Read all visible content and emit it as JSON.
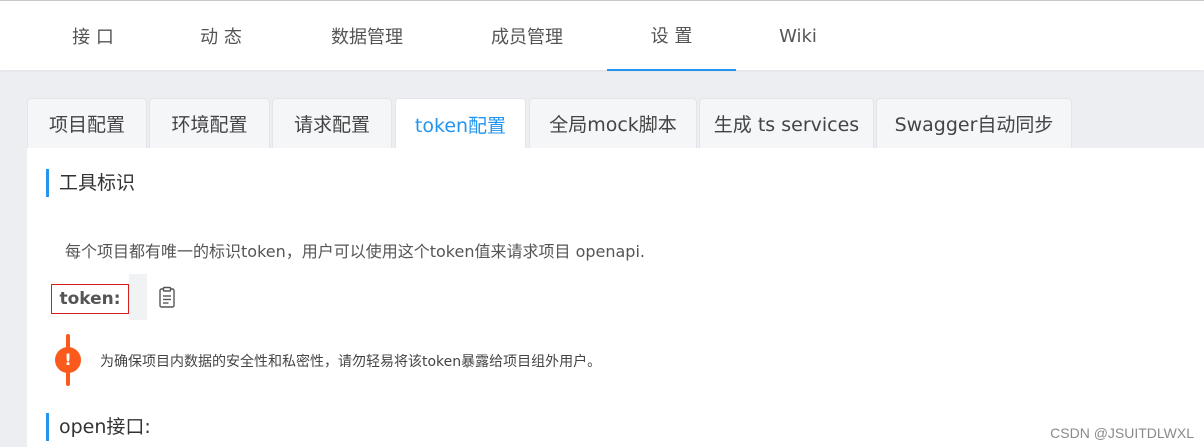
{
  "topnav": {
    "items": [
      {
        "label": "接 口",
        "active": false
      },
      {
        "label": "动 态",
        "active": false
      },
      {
        "label": "数据管理",
        "active": false
      },
      {
        "label": "成员管理",
        "active": false
      },
      {
        "label": "设 置",
        "active": true
      },
      {
        "label": "Wiki",
        "active": false
      }
    ]
  },
  "subtabs": {
    "items": [
      {
        "label": "项目配置",
        "active": false
      },
      {
        "label": "环境配置",
        "active": false
      },
      {
        "label": "请求配置",
        "active": false
      },
      {
        "label": "token配置",
        "active": true
      },
      {
        "label": "全局mock脚本",
        "active": false
      },
      {
        "label": "生成 ts services",
        "active": false
      },
      {
        "label": "Swagger自动同步",
        "active": false
      }
    ]
  },
  "panel": {
    "section1_title": "工具标识",
    "description": "每个项目都有唯一的标识token，用户可以使用这个token值来请求项目 openapi.",
    "token_label": "token:",
    "token_value": "",
    "warning_icon": "!",
    "warning_text": "为确保项目内数据的安全性和私密性，请勿轻易将该token暴露给项目组外用户。",
    "section2_title": "open接口:"
  },
  "watermark": "CSDN @JSUITDLWXL",
  "colors": {
    "accent": "#2395f1",
    "warning": "#fa5a1c",
    "highlight_box": "#d62020"
  },
  "icons": {
    "copy": "copy-icon"
  }
}
